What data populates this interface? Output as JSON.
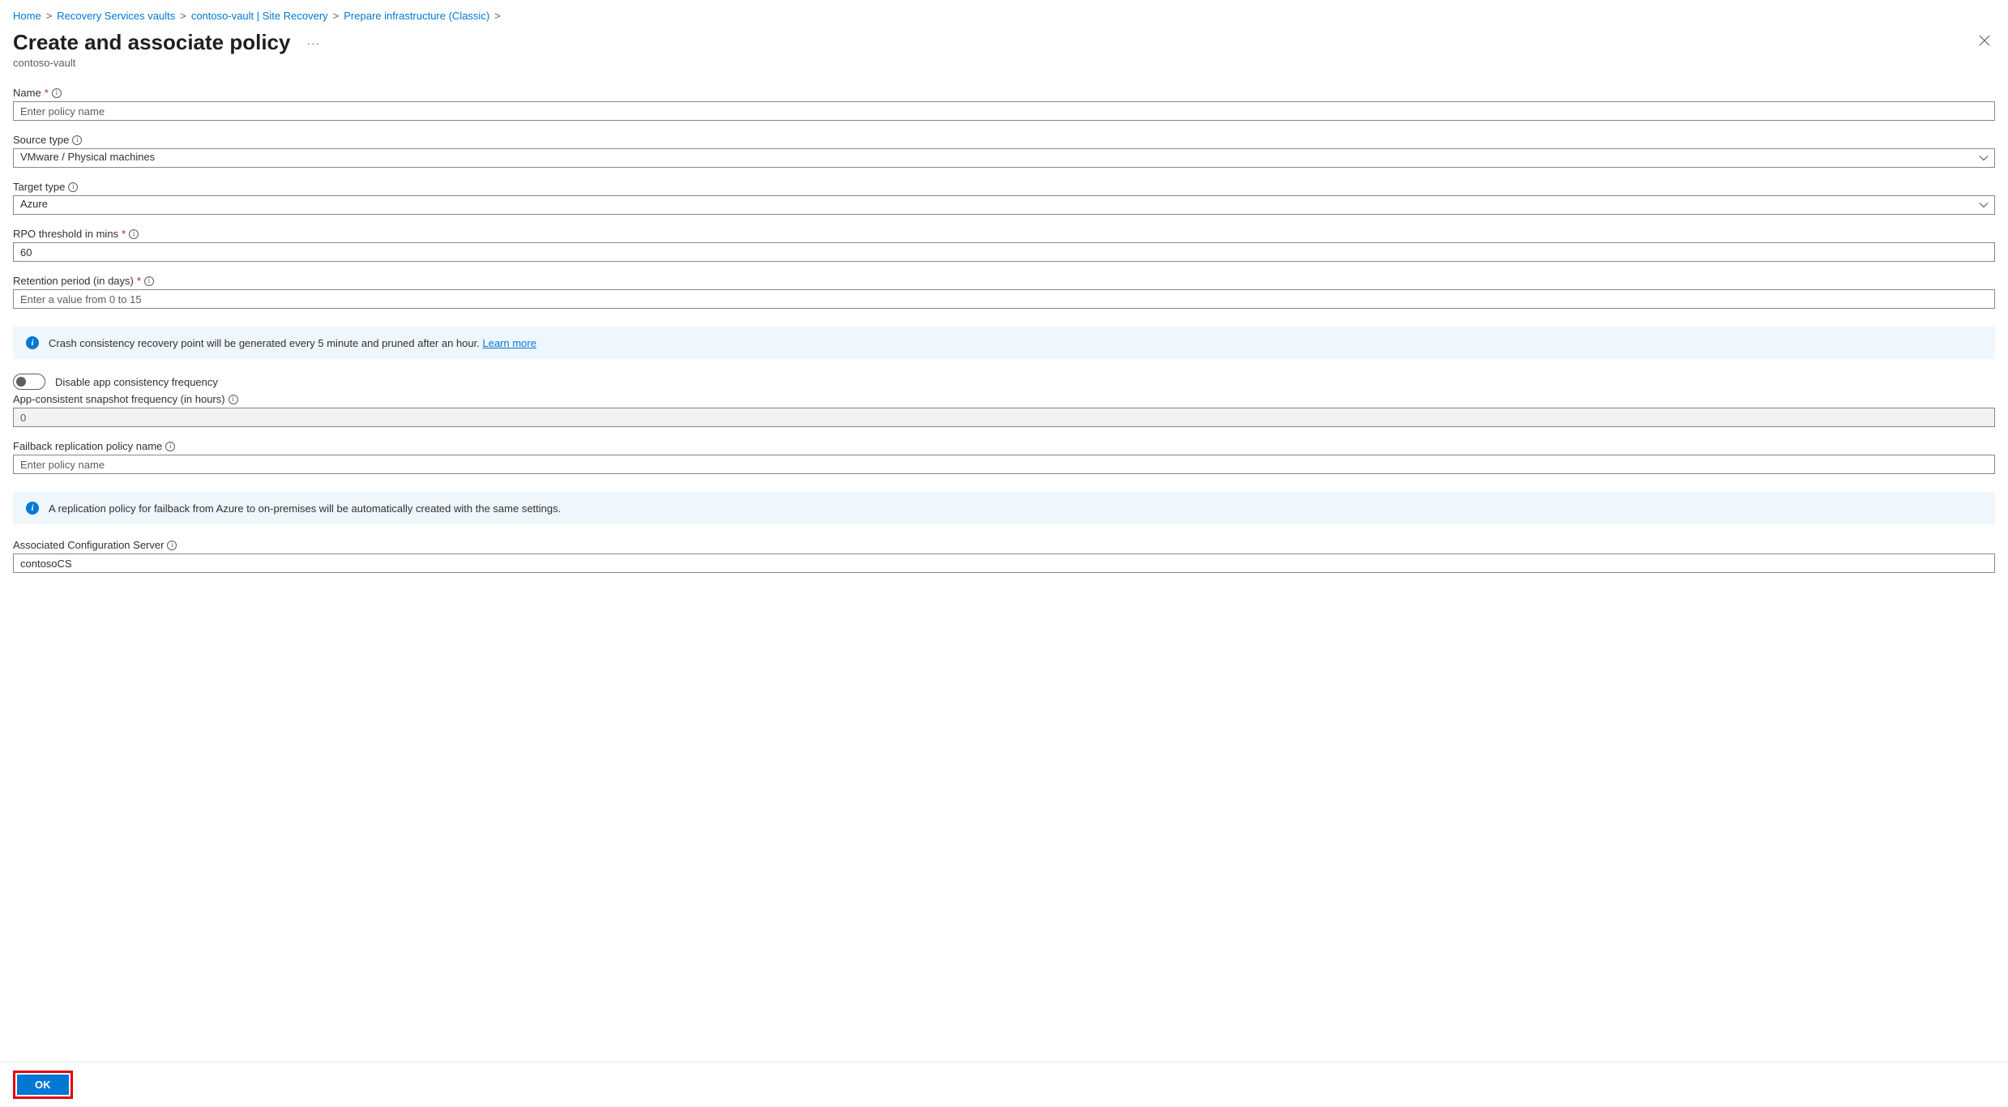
{
  "breadcrumb": {
    "items": [
      "Home",
      "Recovery Services vaults",
      "contoso-vault | Site Recovery",
      "Prepare infrastructure (Classic)"
    ]
  },
  "header": {
    "title": "Create and associate policy",
    "subtitle": "contoso-vault"
  },
  "fields": {
    "name": {
      "label": "Name",
      "placeholder": "Enter policy name",
      "value": ""
    },
    "source_type": {
      "label": "Source type",
      "value": "VMware / Physical machines"
    },
    "target_type": {
      "label": "Target type",
      "value": "Azure"
    },
    "rpo_threshold": {
      "label": "RPO threshold in mins",
      "value": "60"
    },
    "retention": {
      "label": "Retention period (in days)",
      "placeholder": "Enter a value from 0 to 15",
      "value": ""
    },
    "toggle_label": "Disable app consistency frequency",
    "app_snapshot": {
      "label": "App-consistent snapshot frequency (in hours)",
      "value": "0"
    },
    "failback": {
      "label": "Failback replication policy name",
      "placeholder": "Enter policy name",
      "value": ""
    },
    "config_server": {
      "label": "Associated Configuration Server",
      "value": "contosoCS"
    }
  },
  "banners": {
    "crash_consistency": {
      "text": "Crash consistency recovery point will be generated every 5 minute and pruned after an hour. ",
      "link": "Learn more"
    },
    "failback_note": "A replication policy for failback from Azure to on-premises will be automatically created with the same settings."
  },
  "footer": {
    "ok_label": "OK"
  }
}
